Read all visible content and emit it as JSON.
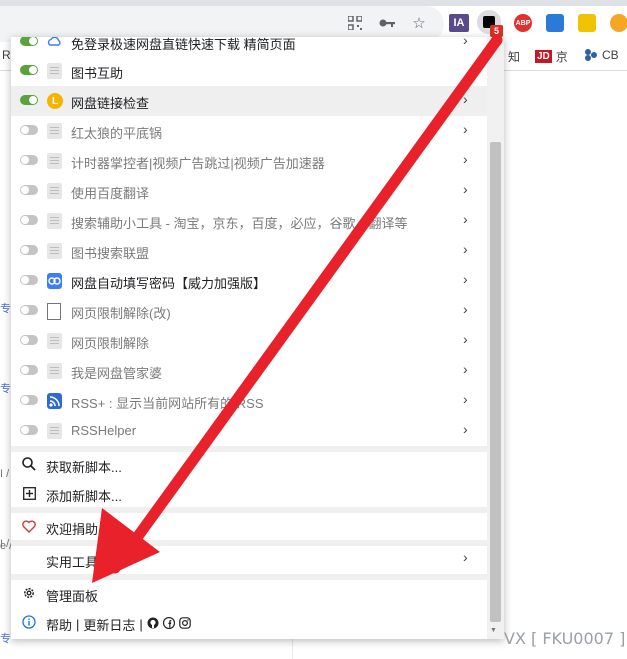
{
  "toolbar": {
    "ext_ia_label": "IA",
    "ext_abp_label": "ABP",
    "tampermonkey_badge": "5"
  },
  "bookmarks": {
    "zhihu": "知",
    "jd_logo": "JD",
    "jd": "京",
    "cb": "CB"
  },
  "menu": {
    "scripts": [
      {
        "label": "免登录极速网盘直链快速下载 精简页面",
        "enabled": true,
        "icon": "cloud-icon"
      },
      {
        "label": "图书互助",
        "enabled": true,
        "icon": "document-icon"
      },
      {
        "label": "网盘链接检查",
        "enabled": true,
        "icon": "yellow-l-icon",
        "icon_text": "L"
      },
      {
        "label": "红太狼的平底锅",
        "enabled": false,
        "icon": "document-icon"
      },
      {
        "label": "计时器掌控者|视频广告跳过|视频广告加速器",
        "enabled": false,
        "icon": "document-icon"
      },
      {
        "label": "使用百度翻译",
        "enabled": false,
        "icon": "document-icon"
      },
      {
        "label": "搜索辅助小工具 - 淘宝，京东，百度，必应，谷歌，翻译等",
        "enabled": false,
        "icon": "document-icon"
      },
      {
        "label": "图书搜索联盟",
        "enabled": false,
        "icon": "document-icon"
      },
      {
        "label": "网盘自动填写密码【威力加强版】",
        "enabled": false,
        "icon": "link-icon"
      },
      {
        "label": "网页限制解除(改)",
        "enabled": false,
        "icon": "page-icon"
      },
      {
        "label": "网页限制解除",
        "enabled": false,
        "icon": "document-icon"
      },
      {
        "label": "我是网盘管家婆",
        "enabled": false,
        "icon": "document-icon"
      },
      {
        "label": "RSS+ : 显示当前网站所有的 RSS",
        "enabled": false,
        "icon": "rss-icon"
      },
      {
        "label": "RSSHelper",
        "enabled": false,
        "icon": "document-icon"
      }
    ],
    "get_new_scripts": "获取新脚本...",
    "add_new_script": "添加新脚本...",
    "donate": "欢迎捐助",
    "utilities": "实用工具",
    "dashboard": "管理面板",
    "help": "帮助",
    "pipe1": "|",
    "changelog": "更新日志",
    "pipe2": "|"
  },
  "overlay": {
    "watermark": "VX [ FKU0007 ]",
    "arrow_color": "#e8212b"
  },
  "background": {
    "snip1": "专",
    "snip2": "专",
    "snip3": "I /",
    "snip4": "I /",
    "snip5": "e /",
    "snip6": "专",
    "bookmark_left": "R"
  }
}
